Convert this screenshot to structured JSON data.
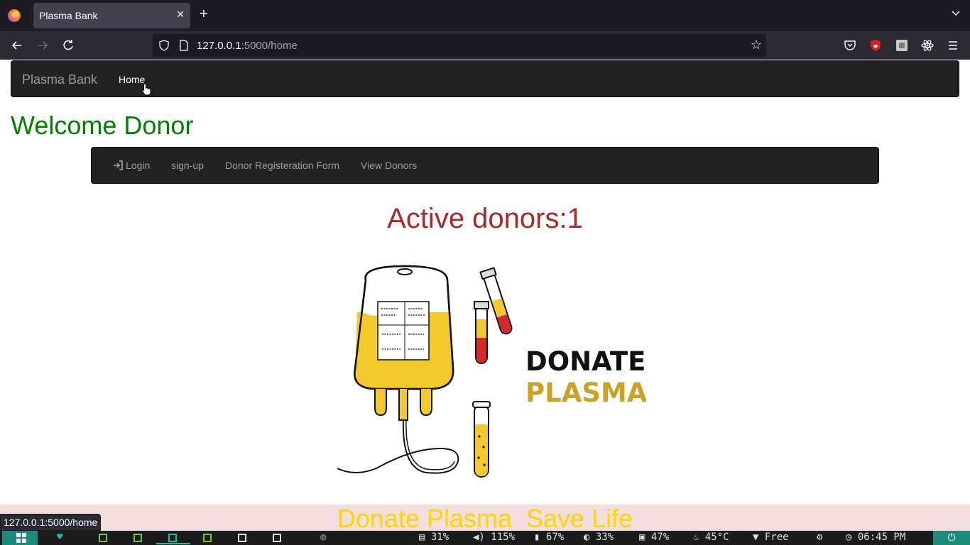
{
  "browser": {
    "tab_title": "Plasma Bank",
    "tab_close": "✕",
    "new_tab": "+",
    "url_host": "127.0.0.1",
    "url_path": ":5000/home",
    "status_url": "127.0.0.1:5000/home"
  },
  "site_nav": {
    "brand": "Plasma Bank",
    "home": "Home"
  },
  "page": {
    "welcome": "Welcome Donor",
    "active_donors": "Active donors:1",
    "image": {
      "line1": "DONATE",
      "line2": "PLASMA",
      "colors": {
        "plasma": "#f2c92c",
        "blood": "#d42a2a",
        "text": "#111111",
        "gold_text": "#c9a227"
      }
    },
    "footer": "Donate Plasma  Save Life"
  },
  "sub_nav": {
    "items": [
      "Login",
      "sign-up",
      "Donor Registeration Form",
      "View Donors"
    ]
  },
  "taskbar": {
    "stats": [
      {
        "icon": "storage-icon",
        "value": "31%"
      },
      {
        "icon": "volume-icon",
        "value": "115%"
      },
      {
        "icon": "battery-icon",
        "value": "67%"
      },
      {
        "icon": "brightness-icon",
        "value": "33%"
      },
      {
        "icon": "cpu-icon",
        "value": "47%"
      },
      {
        "icon": "temperature-icon",
        "value": "45°C"
      },
      {
        "icon": "wifi-icon",
        "value": "Free"
      },
      {
        "icon": "clock-icon",
        "value": "06:45 PM"
      }
    ]
  },
  "colors": {
    "welcome": "#008000",
    "active_donors": "#a52a2a",
    "footer_bg": "#f2dede",
    "footer_text": "#ffd700",
    "navbar_bg": "#222222"
  }
}
